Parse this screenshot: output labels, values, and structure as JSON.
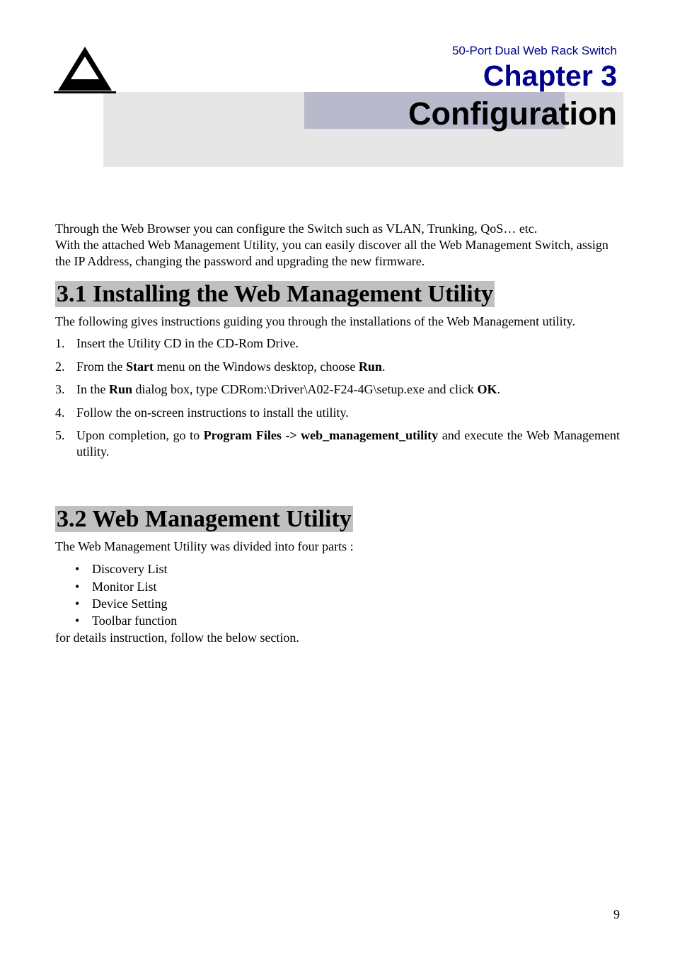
{
  "header": {
    "product_name": "50-Port Dual Web Rack Switch",
    "chapter_label": "Chapter 3",
    "chapter_title": "Configuration"
  },
  "intro": {
    "line1": "Through the Web Browser you can configure the Switch such as VLAN, Trunking, QoS… etc.",
    "line2": "With the attached Web Management Utility, you can easily discover all the Web Management Switch, assign the IP Address, changing the password and upgrading the new firmware."
  },
  "section1": {
    "heading": "3.1 Installing the Web Management Utility",
    "desc": "The following gives instructions guiding you through the installations of the Web Management utility.",
    "items": [
      {
        "num": "1",
        "text_a": "Insert the Utility CD in the CD-Rom Drive."
      },
      {
        "num": "2",
        "text_a": "From the ",
        "bold_b": "Start",
        "text_c": " menu on the Windows desktop, choose ",
        "bold_d": "Run",
        "text_e": "."
      },
      {
        "num": "3",
        "text_a": "In the ",
        "bold_b": "Run",
        "text_c": " dialog box, type CDRom:\\Driver\\A02-F24-4G\\setup.exe and click ",
        "bold_d": "OK",
        "text_e": "."
      },
      {
        "num": "4",
        "text_a": "Follow the on-screen instructions to install the utility."
      },
      {
        "num": "5",
        "text_a": "Upon completion, go to ",
        "bold_b": "Program Files -> web_management_utility",
        "text_c": " and execute the Web Management utility."
      }
    ]
  },
  "section2": {
    "heading": "3.2 Web Management Utility",
    "desc": "The Web Management Utility was divided into four parts :",
    "bullets": [
      "Discovery List",
      "Monitor List",
      "Device Setting",
      "Toolbar function"
    ],
    "footer_line": "for details instruction, follow the below section."
  },
  "page_number": "9"
}
